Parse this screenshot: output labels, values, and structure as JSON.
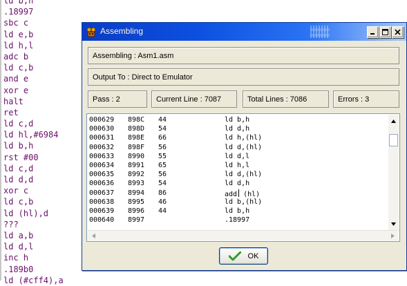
{
  "editor": {
    "lines": [
      "ld b,h",
      ".18997",
      "sbc c",
      "ld e,b",
      "ld h,l",
      "adc b",
      "ld c,b",
      "and e",
      "xor e",
      "halt",
      "ret",
      "ld c,d",
      "ld hl,#6984",
      "ld b,h",
      "rst #00",
      "ld c,d",
      "ld d,d",
      "xor c",
      "ld c,b",
      "ld (hl),d",
      "???",
      "ld a,b",
      "ld d,l",
      "inc h",
      ".189b0",
      "ld (#cff4),a"
    ]
  },
  "dialog": {
    "title": "Assembling",
    "file_label": "Assembling : Asm1.asm",
    "output_label": "Output To : Direct to Emulator",
    "pass": "Pass : 2",
    "current_line": "Current Line : 7087",
    "total_lines": "Total Lines : 7086",
    "errors": "Errors : 3",
    "listing": [
      {
        "line": "000629",
        "addr": "898C",
        "byte": "44",
        "instr": "ld b,h"
      },
      {
        "line": "000630",
        "addr": "898D",
        "byte": "54",
        "instr": "ld d,h"
      },
      {
        "line": "000631",
        "addr": "898E",
        "byte": "66",
        "instr": "ld h,(hl)"
      },
      {
        "line": "000632",
        "addr": "898F",
        "byte": "56",
        "instr": "ld d,(hl)"
      },
      {
        "line": "000633",
        "addr": "8990",
        "byte": "55",
        "instr": "ld d,l"
      },
      {
        "line": "000634",
        "addr": "8991",
        "byte": "65",
        "instr": "ld h,l"
      },
      {
        "line": "000635",
        "addr": "8992",
        "byte": "56",
        "instr": "ld d,(hl)"
      },
      {
        "line": "000636",
        "addr": "8993",
        "byte": "54",
        "instr": "ld d,h"
      },
      {
        "line": "000637",
        "addr": "8994",
        "byte": "86",
        "instr": "add (hl)"
      },
      {
        "line": "000638",
        "addr": "8995",
        "byte": "46",
        "instr": "ld b,(hl)"
      },
      {
        "line": "000639",
        "addr": "8996",
        "byte": "44",
        "instr": "ld b,h"
      },
      {
        "line": "000640",
        "addr": "8997",
        "byte": "",
        "instr": ".18997"
      }
    ],
    "ok_label": "OK"
  },
  "colors": {
    "titlebar": "#0a3cc7",
    "dialog_bg": "#ece9d8",
    "editor_text": "#6a0e6a",
    "ok_check": "#2e9e2e"
  },
  "icons": {
    "app": "app-icon",
    "minimize": "minimize-icon",
    "maximize": "maximize-icon",
    "close": "close-icon",
    "ok": "checkmark-icon"
  }
}
